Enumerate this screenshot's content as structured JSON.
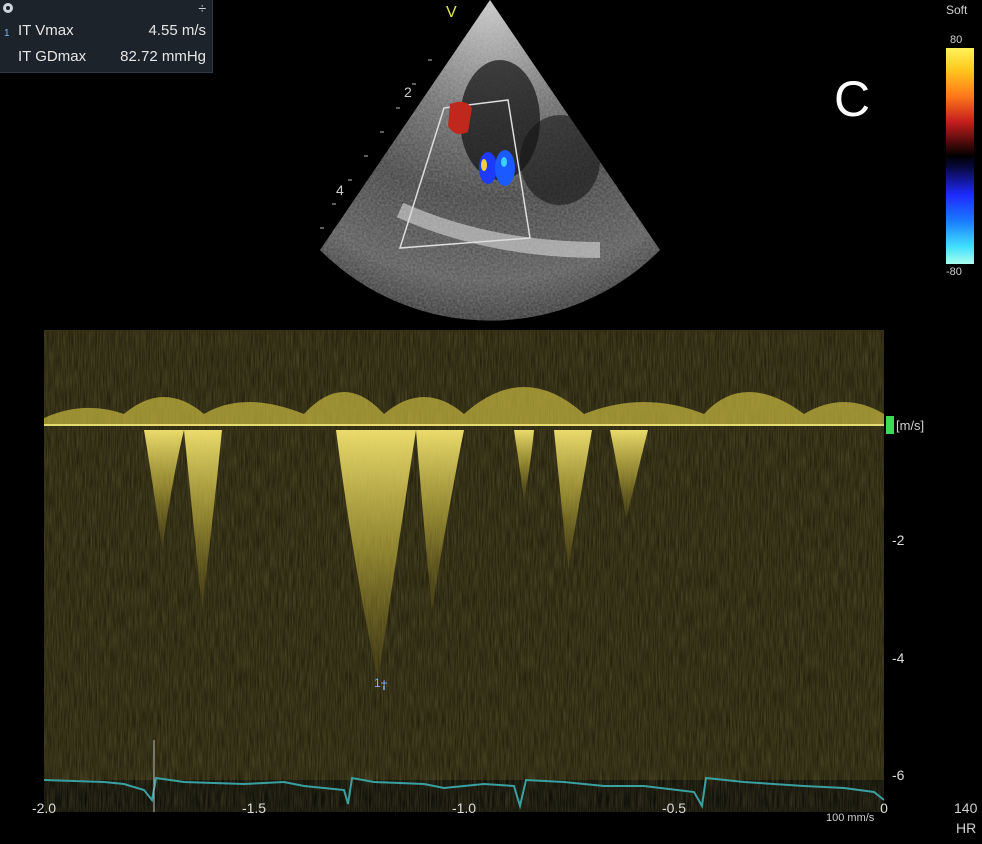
{
  "measurements": [
    {
      "index": "1",
      "label": "IT Vmax",
      "value": "4.55 m/s"
    },
    {
      "index": "",
      "label": "IT GDmax",
      "value": "82.72 mmHg"
    }
  ],
  "move_symbol": "÷",
  "panel_letter": "C",
  "probe_marker": "V",
  "depth_labels": [
    "2",
    "4"
  ],
  "colorbar": {
    "title": "Soft",
    "max": "80",
    "min": "-80"
  },
  "velocity_unit": "[m/s]",
  "velocity_ticks": [
    "-2",
    "-4",
    "-6"
  ],
  "time_ticks": [
    "-2.0",
    "-1.5",
    "-1.0",
    "-0.5",
    "0"
  ],
  "sweep_speed": "100 mm/s",
  "heart_rate": {
    "value": "140",
    "label": "HR"
  },
  "cursor_label": "1+",
  "colors": {
    "doppler": "#e8d860",
    "ecg": "#3aa0a0",
    "baseline": "#e8d870",
    "unit_marker": "#3adb5a"
  }
}
